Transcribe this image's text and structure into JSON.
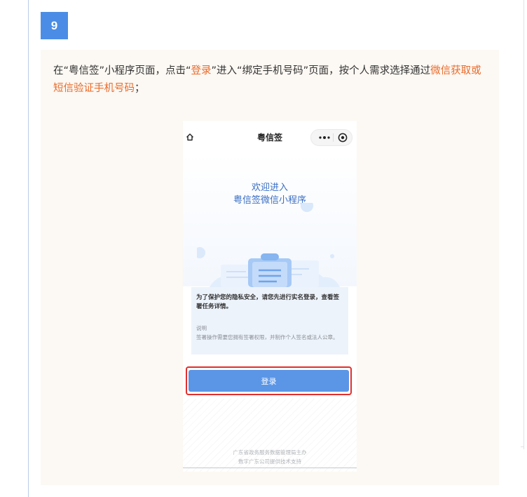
{
  "step": {
    "number": "9",
    "color": "#4b8de6"
  },
  "instruction": {
    "t1": "在“粤信签”小程序页面，点击“",
    "login_link": "登录",
    "t2": "”进入“绑定手机号码”页面，按个人需求选择通过",
    "method_link": "微信获取或短信验证手机号码",
    "t3": "；",
    "highlight_color": "#e96b2a"
  },
  "phone": {
    "nav_title": "粤信签",
    "icons": [
      "home-icon",
      "more-icon",
      "target-icon"
    ],
    "welcome_line1": "欢迎进入",
    "welcome_line2": "粤信签微信小程序",
    "notice_main": "为了保护您的隐私安全，请您先进行实名登录，查看签署任务详情。",
    "notice_sub_title": "说明",
    "notice_sub": "签署操作需要您拥有签署权限，并制作个人签名或法人公章。",
    "login_button": "登录",
    "footer_line1": "广东省政务服务数据管理局主办",
    "footer_line2": "数字广东公司提供技术支持",
    "button_color": "#5b95e6",
    "outline_color": "#e2302c"
  }
}
